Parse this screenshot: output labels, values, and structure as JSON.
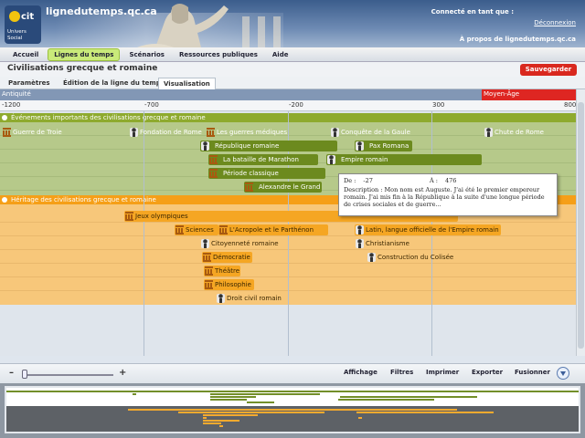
{
  "header": {
    "site_name": "lignedutemps.qc.ca",
    "logo_text": "récit univers social",
    "logged_label": "Connecté en tant que :",
    "logout": "Déconnexion",
    "about": "À propos de lignedutemps.qc.ca"
  },
  "nav": {
    "items": [
      "Accueil",
      "Lignes du temps",
      "Scénarios",
      "Ressources publiques",
      "Aide"
    ],
    "active_index": 1
  },
  "page": {
    "title": "Civilisations grecque et romaine",
    "save_label": "Sauvegarder"
  },
  "subtabs": {
    "items": [
      "Paramètres",
      "Édition de la ligne du temps",
      "Visualisation"
    ],
    "active_index": 2
  },
  "timeline": {
    "periods": [
      "Antiquité",
      "Moyen-Âge"
    ],
    "ticks": [
      "-1200",
      "-700",
      "-200",
      "300",
      "800"
    ],
    "section1": {
      "title": "Événements importants des civilisations grecque et romaine",
      "events": [
        {
          "label": "Guerre de Troie",
          "icon": "temple-icon"
        },
        {
          "label": "Fondation de Rome",
          "icon": "person-icon"
        },
        {
          "label": "Les guerres médiques",
          "icon": "temple-icon"
        },
        {
          "label": "Conquête de la Gaule",
          "icon": "person-icon"
        },
        {
          "label": "Chute de Rome",
          "icon": "person-icon"
        },
        {
          "label": "République romaine",
          "icon": "person-icon"
        },
        {
          "label": "Pax Romana",
          "icon": "person-icon"
        },
        {
          "label": "La bataille de Marathon",
          "icon": "temple-icon"
        },
        {
          "label": "Empire romain",
          "icon": "person-icon"
        },
        {
          "label": "Période classique",
          "icon": "temple-icon"
        },
        {
          "label": "Alexandre le Grand",
          "icon": "temple-icon"
        }
      ]
    },
    "section2": {
      "title": "Héritage des civilisations grecque et romaine",
      "events": [
        {
          "label": "Jeux olympiques",
          "icon": "temple-icon"
        },
        {
          "label": "Sciences",
          "icon": "temple-icon"
        },
        {
          "label": "L'Acropole et le Parthénon",
          "icon": "temple-icon"
        },
        {
          "label": "Latin, langue officielle de l'Empire romain",
          "icon": "person-icon"
        },
        {
          "label": "Citoyenneté romaine",
          "icon": "person-icon"
        },
        {
          "label": "Christianisme",
          "icon": "person-icon"
        },
        {
          "label": "Démocratie",
          "icon": "temple-icon"
        },
        {
          "label": "Construction du Colisée",
          "icon": "person-icon"
        },
        {
          "label": "Théâtre",
          "icon": "temple-icon"
        },
        {
          "label": "Philosophie",
          "icon": "temple-icon"
        },
        {
          "label": "Droit civil romain",
          "icon": "person-icon"
        }
      ]
    },
    "tooltip": {
      "from_label": "De :",
      "from_value": "-27",
      "to_label": "À :",
      "to_value": "476",
      "description": "Description : Mon nom est Auguste. J'ai été le premier empereur romain. J'ai mis fin à la République à la suite d'une longue période de crises sociales et de guerre..."
    }
  },
  "toolbar": {
    "zoom_minus": "–",
    "zoom_plus": "+",
    "buttons": [
      "Affichage",
      "Filtres",
      "Imprimer",
      "Exporter",
      "Fusionner"
    ]
  },
  "colors": {
    "section1_header": "#8eaa2e",
    "section1_band": "#b6c98a",
    "section2_header": "#f59f18",
    "section2_band": "#f7c77a",
    "save_button": "#d9281e",
    "period_middle_ages": "#de2622"
  }
}
